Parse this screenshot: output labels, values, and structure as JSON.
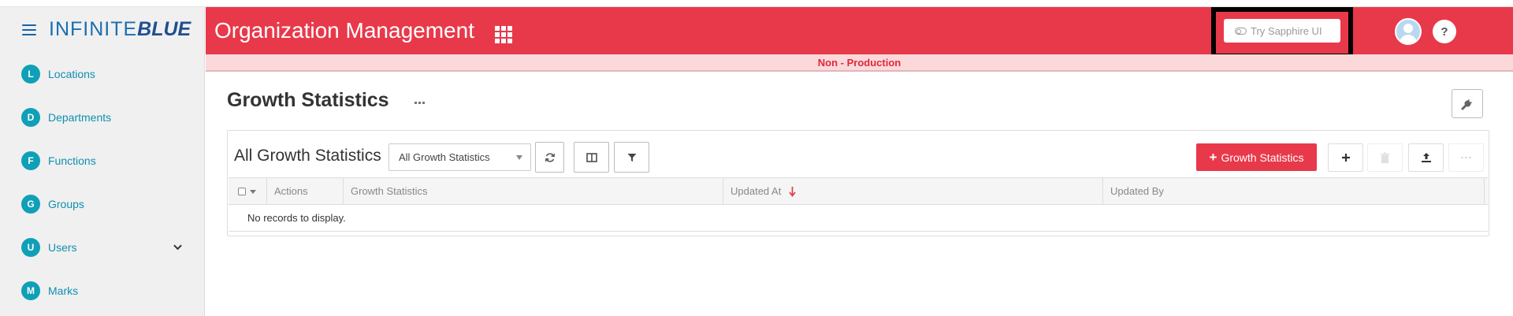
{
  "sidebar": {
    "logo": {
      "thin": "INFINITE",
      "bold": "BLUE"
    },
    "items": [
      {
        "badge": "L",
        "label": "Locations"
      },
      {
        "badge": "D",
        "label": "Departments"
      },
      {
        "badge": "F",
        "label": "Functions"
      },
      {
        "badge": "G",
        "label": "Groups"
      },
      {
        "badge": "U",
        "label": "Users"
      },
      {
        "badge": "M",
        "label": "Marks"
      }
    ]
  },
  "header": {
    "title": "Organization Management",
    "try_button": "Try Sapphire UI",
    "help_glyph": "?",
    "brand_color": "#e8394a"
  },
  "environment": {
    "label": "Non - Production"
  },
  "page": {
    "title": "Growth Statistics",
    "view_title": "All Growth Statistics",
    "view_select": "All Growth Statistics",
    "add_button": "Growth Statistics"
  },
  "grid": {
    "columns": [
      "Actions",
      "Growth Statistics",
      "Updated At",
      "Updated By"
    ],
    "sort_column": "Updated At",
    "sort_direction": "descending",
    "empty_message": "No records to display."
  },
  "icons": [
    "hamburger-icon",
    "apps-grid-icon",
    "toggle-icon",
    "search-icon",
    "help-icon",
    "avatar-icon",
    "more-dots-icon",
    "wrench-icon",
    "refresh-icon",
    "columns-icon",
    "filter-icon",
    "plus-icon",
    "trash-icon",
    "upload-icon",
    "chevron-down-icon",
    "sort-down-icon"
  ]
}
